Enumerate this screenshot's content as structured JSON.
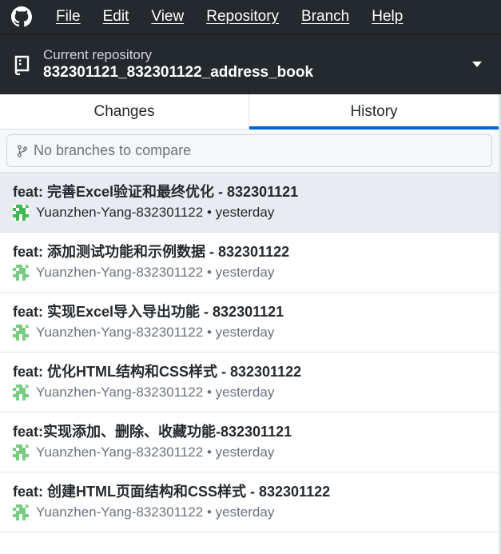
{
  "menubar": {
    "items": [
      {
        "label": "File"
      },
      {
        "label": "Edit"
      },
      {
        "label": "View"
      },
      {
        "label": "Repository"
      },
      {
        "label": "Branch"
      },
      {
        "label": "Help"
      }
    ]
  },
  "repo": {
    "label": "Current repository",
    "name": "832301121_832301122_address_book"
  },
  "tabs": {
    "changes": "Changes",
    "history": "History",
    "active": "History"
  },
  "compare": {
    "placeholder": "No branches to compare"
  },
  "commits": [
    {
      "title": "feat: 完善Excel验证和最终优化 - 832301121",
      "meta": "Yuanzhen-Yang-832301122 • yesterday",
      "selected": true
    },
    {
      "title": "feat: 添加测试功能和示例数据 - 832301122",
      "meta": "Yuanzhen-Yang-832301122 • yesterday",
      "selected": false
    },
    {
      "title": "feat: 实现Excel导入导出功能 - 832301121",
      "meta": "Yuanzhen-Yang-832301122 • yesterday",
      "selected": false
    },
    {
      "title": "feat: 优化HTML结构和CSS样式 - 832301122",
      "meta": "Yuanzhen-Yang-832301122 • yesterday",
      "selected": false
    },
    {
      "title": "feat:实现添加、删除、收藏功能-832301121",
      "meta": "Yuanzhen-Yang-832301122 • yesterday",
      "selected": false
    },
    {
      "title": "feat: 创建HTML页面结构和CSS样式 - 832301122",
      "meta": "Yuanzhen-Yang-832301122 • yesterday",
      "selected": false
    }
  ],
  "colors": {
    "titlebar": "#24292e",
    "accent": "#0366d6",
    "selected_row": "#e8ebef",
    "avatar": "#3fb950"
  }
}
